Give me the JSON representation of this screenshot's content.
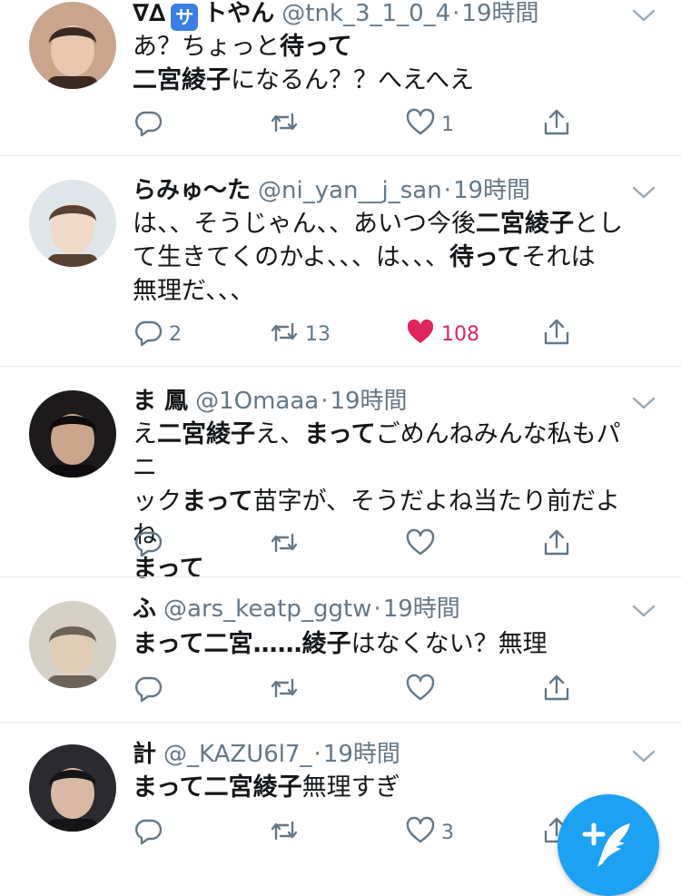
{
  "tweets": [
    {
      "name_prefix": "∇∆",
      "badge": "サ",
      "name": "トやん",
      "handle": "@tnk_3_1_0_4",
      "dot": "·",
      "time": "19時間",
      "lines": [
        [
          {
            "t": "あ？ちょっと",
            "b": false
          },
          {
            "t": "待って",
            "b": true
          }
        ],
        [
          {
            "t": "二宮綾子",
            "b": true
          },
          {
            "t": "になるん？？へえへえ",
            "b": false
          }
        ]
      ],
      "reply_count": "",
      "retweet_count": "",
      "like_count": "1",
      "liked": false
    },
    {
      "name_prefix": "",
      "badge": "",
      "name": "らみゅ〜た",
      "handle": "@ni_yan__j_san",
      "dot": "·",
      "time": "19時間",
      "lines": [
        [
          {
            "t": "は、、そうじゃん、、あいつ今後",
            "b": false
          },
          {
            "t": "二宮綾子",
            "b": true
          },
          {
            "t": "とし",
            "b": false
          }
        ],
        [
          {
            "t": "て生きてくのかよ、、、は、、、",
            "b": false
          },
          {
            "t": "待って",
            "b": true
          },
          {
            "t": "それは",
            "b": false
          }
        ],
        [
          {
            "t": "無理だ、、、",
            "b": false
          }
        ]
      ],
      "reply_count": "2",
      "retweet_count": "13",
      "like_count": "108",
      "liked": true
    },
    {
      "name_prefix": "",
      "badge": "",
      "name": "ま 鳳",
      "handle": "@1Omaaa",
      "dot": "·",
      "time": "19時間",
      "lines": [
        [
          {
            "t": "え",
            "b": false
          },
          {
            "t": "二宮綾子",
            "b": true
          },
          {
            "t": "え、",
            "b": false
          },
          {
            "t": "まって",
            "b": true
          },
          {
            "t": "ごめんねみんな私もパニ",
            "b": false
          }
        ],
        [
          {
            "t": "ック",
            "b": false
          },
          {
            "t": "まって",
            "b": true
          },
          {
            "t": "苗字が、そうだよね当たり前だよね",
            "b": false
          }
        ],
        [
          {
            "t": "まって",
            "b": true
          }
        ]
      ],
      "reply_count": "",
      "retweet_count": "",
      "like_count": "",
      "liked": false
    },
    {
      "name_prefix": "",
      "badge": "",
      "name": "ふ",
      "handle": "@ars_keatp_ggtw",
      "dot": "·",
      "time": "19時間",
      "lines": [
        [
          {
            "t": "まって二宮……綾子",
            "b": true
          },
          {
            "t": "はなくない？無理",
            "b": false
          }
        ]
      ],
      "reply_count": "",
      "retweet_count": "",
      "like_count": "",
      "liked": false
    },
    {
      "name_prefix": "",
      "badge": "",
      "name": "計",
      "handle": "@_KAZU6l7_",
      "dot": "·",
      "time": "19時間",
      "lines": [
        [
          {
            "t": "まって二宮綾子",
            "b": true
          },
          {
            "t": "無理すぎ",
            "b": false
          }
        ]
      ],
      "reply_count": "",
      "retweet_count": "",
      "like_count": "3",
      "liked": false
    }
  ],
  "icons": {
    "reply": "reply-icon",
    "retweet": "retweet-icon",
    "like": "heart-icon",
    "share": "share-icon",
    "more": "chevron-down-icon",
    "compose": "compose-tweet-icon"
  },
  "colors": {
    "accent": "#1da1f2",
    "like": "#e0245e",
    "muted": "#657786",
    "divider": "#e1e8ed"
  }
}
